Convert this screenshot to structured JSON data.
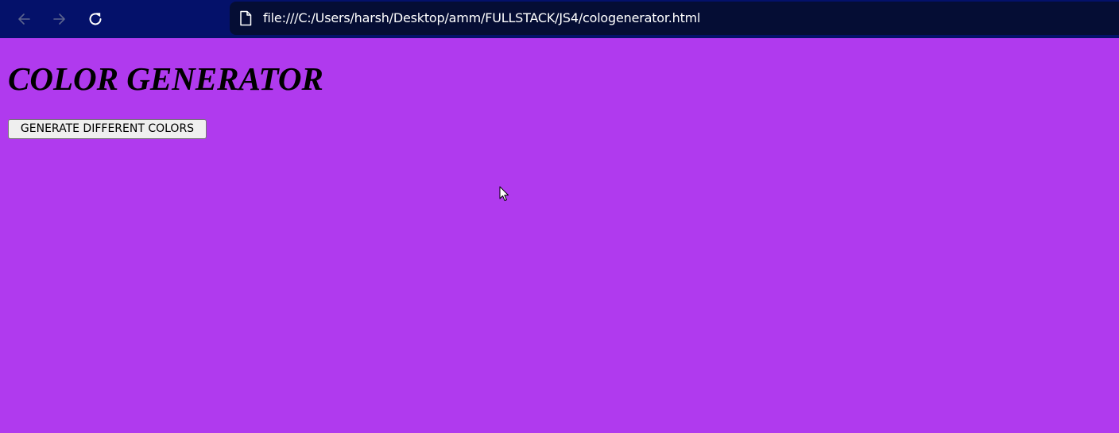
{
  "browser": {
    "url": "file:///C:/Users/harsh/Desktop/amm/FULLSTACK/JS4/cologenerator.html",
    "back_icon": "arrow-left-icon",
    "forward_icon": "arrow-right-icon",
    "reload_icon": "reload-icon",
    "page_icon": "page-icon",
    "toolbar_color": "#04116a",
    "address_bar_color": "#050d34"
  },
  "page": {
    "title": "COLOR GENERATOR",
    "button_label": "GENERATE DIFFERENT COLORS",
    "background_color": "#b03aee"
  }
}
